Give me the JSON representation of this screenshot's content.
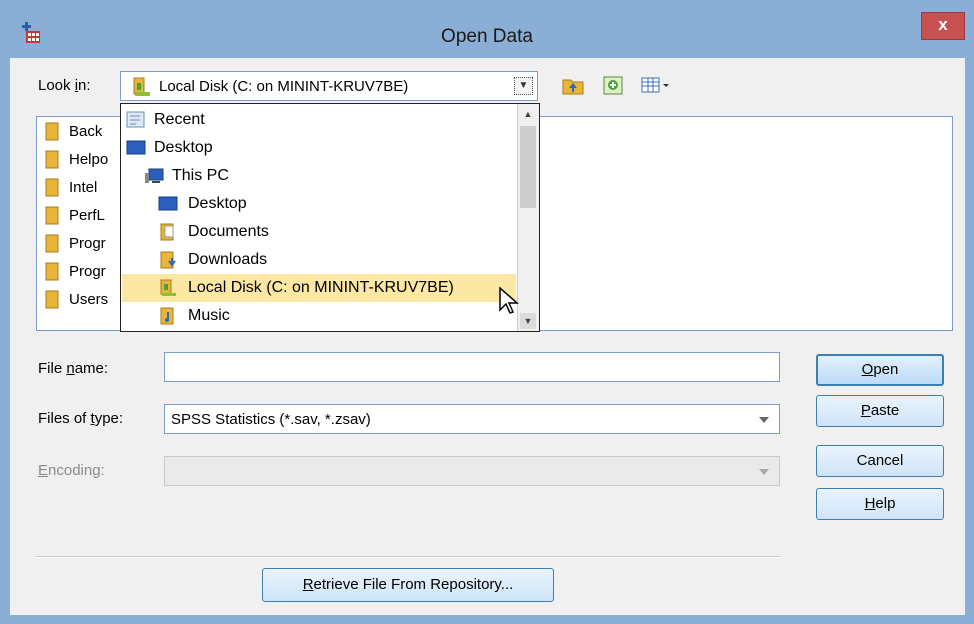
{
  "window": {
    "title": "Open Data",
    "close_label": "x"
  },
  "look_in": {
    "label_prefix": "Look ",
    "label_accel": "i",
    "label_suffix": "n:",
    "value": "Local Disk (C: on MININT-KRUV7BE)"
  },
  "file_list": [
    {
      "name": "Back"
    },
    {
      "name": "Helpo"
    },
    {
      "name": "Intel"
    },
    {
      "name": "PerfL"
    },
    {
      "name": "Progr"
    },
    {
      "name": "Progr"
    },
    {
      "name": "Users"
    }
  ],
  "dropdown_items": [
    {
      "label": "Recent"
    },
    {
      "label": "Desktop"
    },
    {
      "label": "This PC"
    },
    {
      "label": "Desktop"
    },
    {
      "label": "Documents"
    },
    {
      "label": "Downloads"
    },
    {
      "label": "Local Disk (C: on MININT-KRUV7BE)"
    },
    {
      "label": "Music"
    }
  ],
  "file_name": {
    "label_prefix": "File ",
    "label_accel": "n",
    "label_suffix": "ame:",
    "value": ""
  },
  "files_of_type": {
    "label_prefix": "Files of ",
    "label_accel": "t",
    "label_suffix": "ype:",
    "value": "SPSS Statistics (*.sav, *.zsav)"
  },
  "encoding": {
    "label_accel": "E",
    "label_suffix": "ncoding:",
    "value": ""
  },
  "buttons": {
    "open_accel": "O",
    "open_rest": "pen",
    "paste_accel": "P",
    "paste_rest": "aste",
    "cancel": "Cancel",
    "help_accel": "H",
    "help_rest": "elp",
    "retrieve_accel": "R",
    "retrieve_rest": "etrieve File From Repository..."
  },
  "colors": {
    "frame": "#8aaed6",
    "selection": "#fde7a5",
    "button_border": "#3c7fb1"
  }
}
